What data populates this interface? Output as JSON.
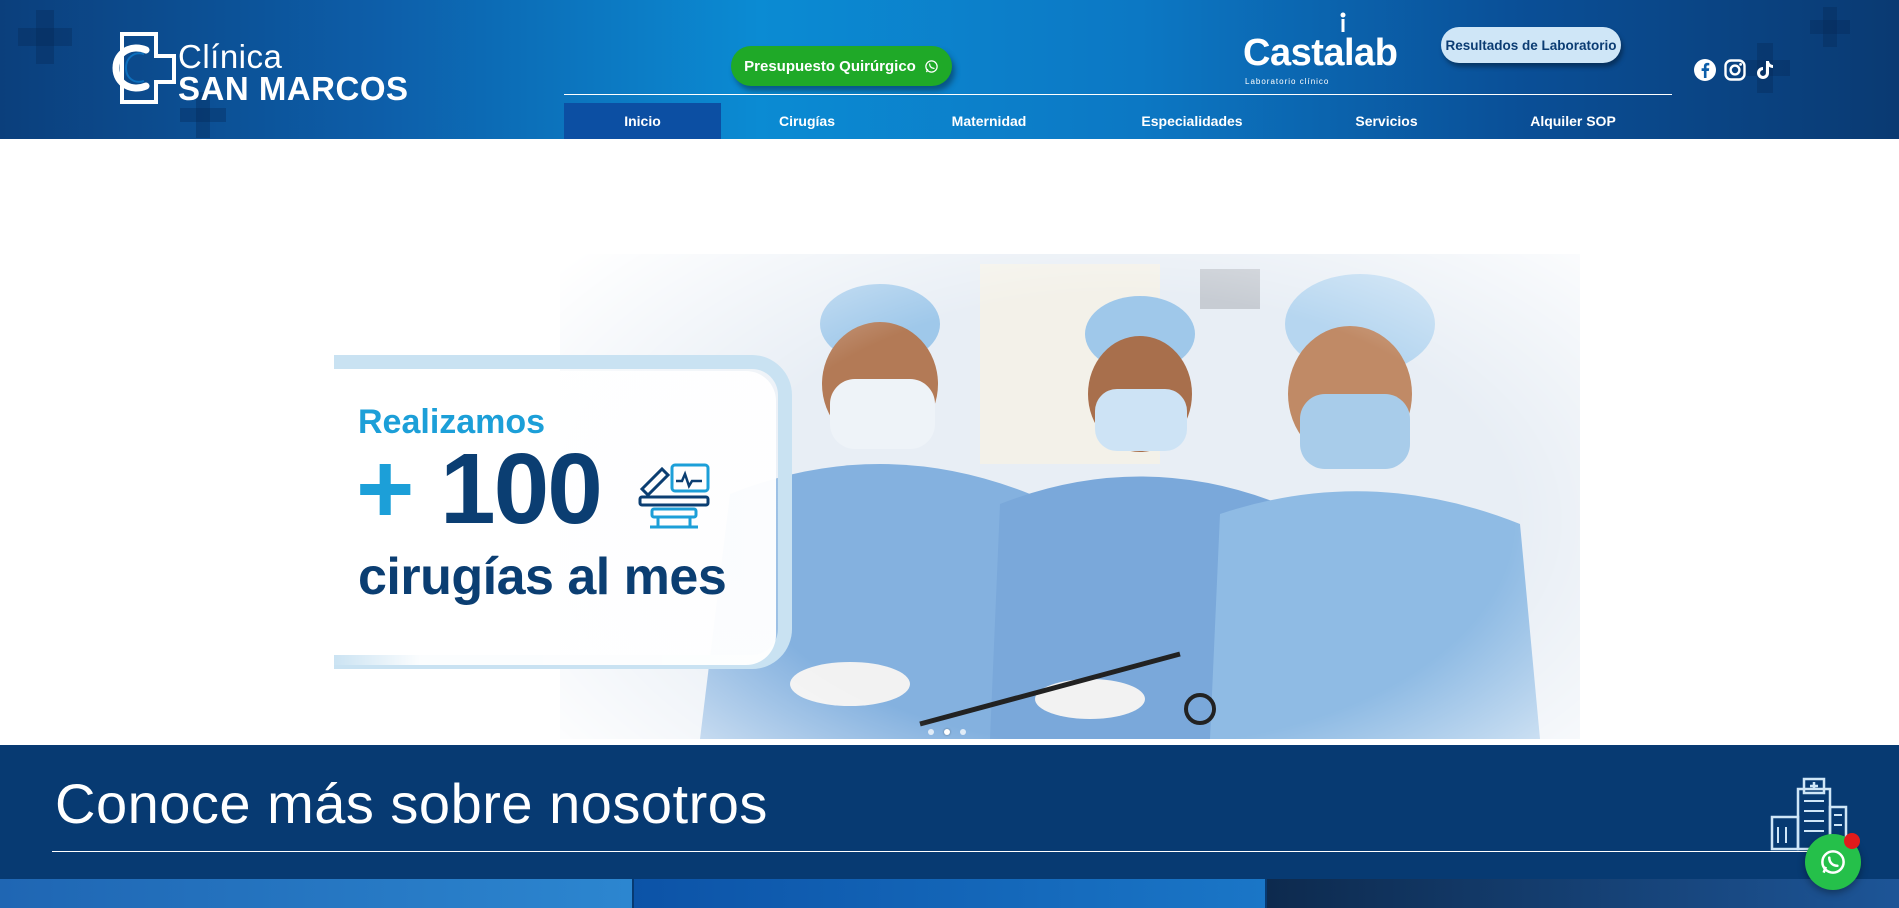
{
  "header": {
    "logo": {
      "line1": "Clínica",
      "line2": "SAN MARCOS"
    },
    "cta_budget": {
      "label": "Presupuesto Quirúrgico",
      "icon": "whatsapp-icon"
    },
    "partner_logo": {
      "name": "Castalab",
      "subtitle": "Laboratorio clínico"
    },
    "lab_results_button": "Resultados de Laboratorio",
    "social": [
      "facebook-icon",
      "instagram-icon",
      "tiktok-icon"
    ]
  },
  "nav": {
    "items": [
      {
        "label": "Inicio",
        "active": true
      },
      {
        "label": "Cirugías",
        "active": false
      },
      {
        "label": "Maternidad",
        "active": false
      },
      {
        "label": "Especialidades",
        "active": false
      },
      {
        "label": "Servicios",
        "active": false
      },
      {
        "label": "Alquiler SOP",
        "active": false
      }
    ]
  },
  "hero": {
    "kicker": "Realizamos",
    "plus": "+",
    "number": "100",
    "tagline": "cirugías al mes",
    "equipment_icon": "surgery-equipment-icon",
    "carousel": {
      "slides": 3,
      "active_index": 1
    }
  },
  "about": {
    "title": "Conoce más sobre nosotros",
    "icon": "hospital-building-icon"
  },
  "floating": {
    "icon": "whatsapp-icon",
    "badge_color": "#e11b1b"
  },
  "colors": {
    "brand_dark": "#0b3e72",
    "brand_light": "#1c9fd8",
    "cta_green": "#1fa928",
    "nav_active": "#0c4fa3",
    "about_bg": "#073a72"
  }
}
